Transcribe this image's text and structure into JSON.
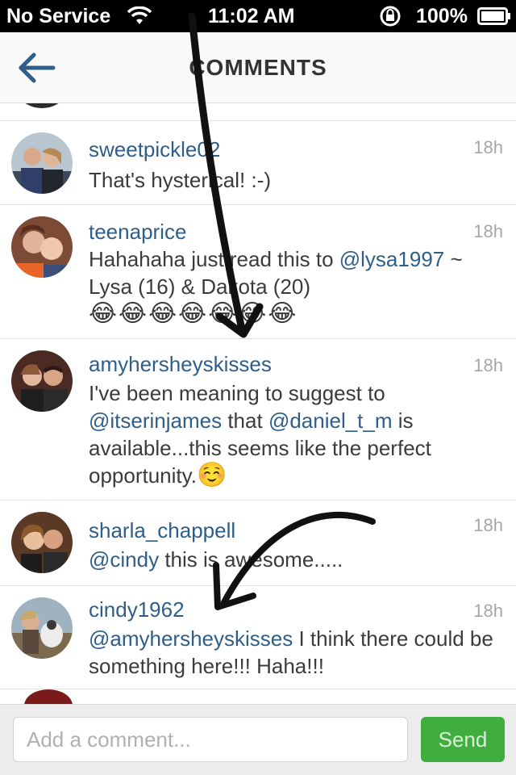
{
  "status_bar": {
    "carrier": "No Service",
    "time": "11:02 AM",
    "battery": "100%"
  },
  "header": {
    "title": "COMMENTS"
  },
  "comments": [
    {
      "username": "sweetpickle02",
      "time": "18h",
      "text": "That's hysterical! :-)"
    },
    {
      "username": "teenaprice",
      "time": "18h",
      "text_before": "Hahahaha just read this to ",
      "mention": "@lysa1997",
      "text_after": " ~ Lysa (16) & Dakota (20)",
      "emoji": "😂😂😂😂😂😂😂"
    },
    {
      "username": "amyhersheyskisses",
      "time": "18h",
      "text_1": "I've been meaning to suggest to ",
      "mention_1": "@itserinjames",
      "text_2": " that ",
      "mention_2": "@daniel_t_m",
      "text_3": " is available...this seems like the perfect opportunity.",
      "emoji": "☺️"
    },
    {
      "username": "sharla_chappell",
      "time": "18h",
      "mention": "@cindy",
      "text": " this is awesome....."
    },
    {
      "username": "cindy1962",
      "time": "18h",
      "mention": "@amyhersheyskisses",
      "text": " I think there could be something here!!! Haha!!!"
    }
  ],
  "composer": {
    "placeholder": "Add a comment...",
    "send_label": "Send"
  },
  "colors": {
    "username": "#2e5e8a",
    "send_button": "#3fae3f",
    "status_bar": "#000000"
  },
  "icons": [
    "wifi-icon",
    "rotation-lock-icon",
    "battery-icon",
    "back-arrow-icon"
  ]
}
